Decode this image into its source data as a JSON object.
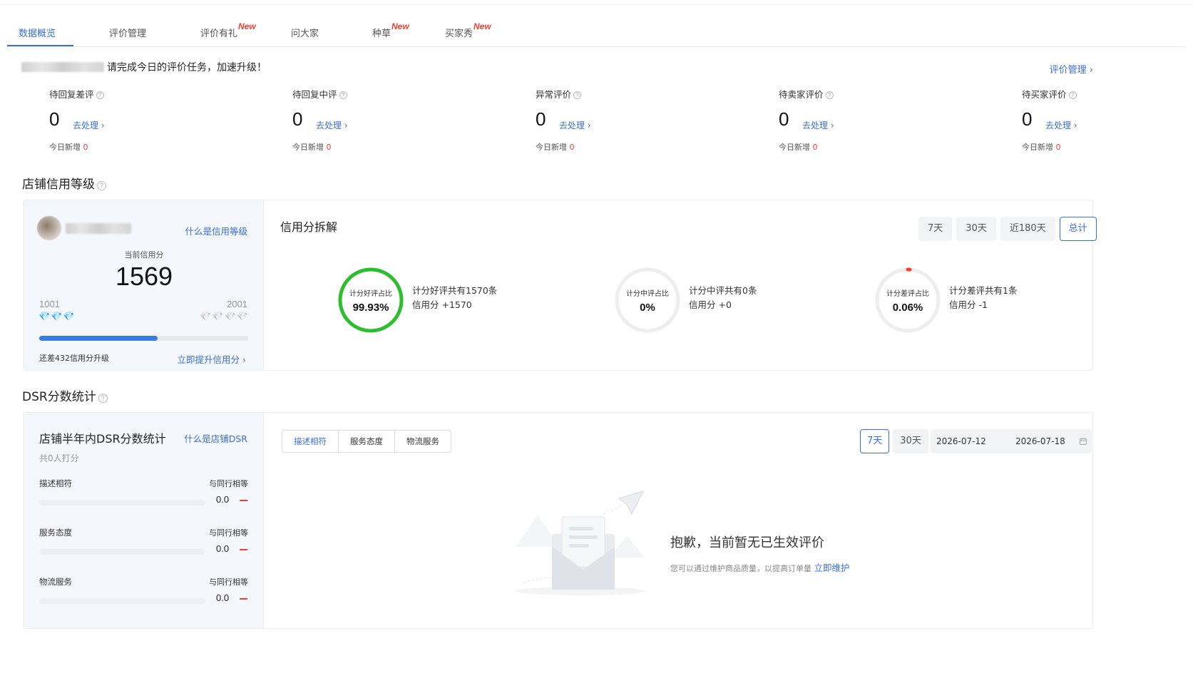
{
  "tabs": [
    {
      "label": "数据概览",
      "active": true,
      "new": false
    },
    {
      "label": "评价管理",
      "active": false,
      "new": false
    },
    {
      "label": "评价有礼",
      "active": false,
      "new": true
    },
    {
      "label": "问大家",
      "active": false,
      "new": false
    },
    {
      "label": "种草",
      "active": false,
      "new": true
    },
    {
      "label": "买家秀",
      "active": false,
      "new": true
    }
  ],
  "new_badge": "New",
  "notice": {
    "text": "请完成今日的评价任务，加速升级！",
    "manage_link": "评价管理 ›"
  },
  "todos": [
    {
      "title": "待回复差评",
      "count": "0",
      "action": "去处理 ›",
      "today_label": "今日新增",
      "today_count": "0"
    },
    {
      "title": "待回复中评",
      "count": "0",
      "action": "去处理 ›",
      "today_label": "今日新增",
      "today_count": "0"
    },
    {
      "title": "异常评价",
      "count": "0",
      "action": "去处理 ›",
      "today_label": "今日新增",
      "today_count": "0"
    },
    {
      "title": "待卖家评价",
      "count": "0",
      "action": "去处理 ›",
      "today_label": "今日新增",
      "today_count": "0"
    },
    {
      "title": "待买家评价",
      "count": "0",
      "action": "去处理 ›",
      "today_label": "今日新增",
      "today_count": "0"
    }
  ],
  "credit": {
    "section_title": "店铺信用等级",
    "what_link": "什么是信用等级",
    "current_label": "当前信用分",
    "score": "1569",
    "range_min": "1001",
    "range_max": "2001",
    "progress_fraction": 0.567,
    "gap_text": "还差432信用分升级",
    "boost_link": "立即提升信用分 ›",
    "breakdown_title": "信用分拆解",
    "ranges": [
      {
        "label": "7天",
        "active": false
      },
      {
        "label": "30天",
        "active": false
      },
      {
        "label": "近180天",
        "active": false
      },
      {
        "label": "总计",
        "active": true
      }
    ],
    "rings": [
      {
        "label": "计分好评占比",
        "value": "99.93%",
        "fraction": 0.9993,
        "color": "#2cbf2c",
        "desc1": "计分好评共有1570条",
        "desc2": "信用分 +1570"
      },
      {
        "label": "计分中评占比",
        "value": "0%",
        "fraction": 0,
        "color": "#f5a623",
        "desc1": "计分中评共有0条",
        "desc2": "信用分 +0"
      },
      {
        "label": "计分差评占比",
        "value": "0.06%",
        "fraction": 0.0006,
        "color": "#f04134",
        "desc1": "计分差评共有1条",
        "desc2": "信用分 -1"
      }
    ]
  },
  "dsr": {
    "section_title": "DSR分数统计",
    "card_title": "店铺半年内DSR分数统计",
    "what_link": "什么是店铺DSR",
    "count_text": "共0人打分",
    "rows": [
      {
        "label": "描述相符",
        "compare": "与同行相等",
        "value": "0.0",
        "fraction": 0
      },
      {
        "label": "服务态度",
        "compare": "与同行相等",
        "value": "0.0",
        "fraction": 0
      },
      {
        "label": "物流服务",
        "compare": "与同行相等",
        "value": "0.0",
        "fraction": 0
      }
    ],
    "segments": [
      {
        "label": "描述相符",
        "active": true
      },
      {
        "label": "服务态度",
        "active": false
      },
      {
        "label": "物流服务",
        "active": false
      }
    ],
    "ranges": [
      {
        "label": "7天",
        "active": true
      },
      {
        "label": "30天",
        "active": false
      }
    ],
    "date_start": "2026-07-12",
    "date_end": "2026-07-18",
    "empty_title": "抱歉，当前暂无已生效评价",
    "empty_sub": "您可以通过维护商品质量，以提高订单量",
    "empty_link": "立即维护"
  }
}
